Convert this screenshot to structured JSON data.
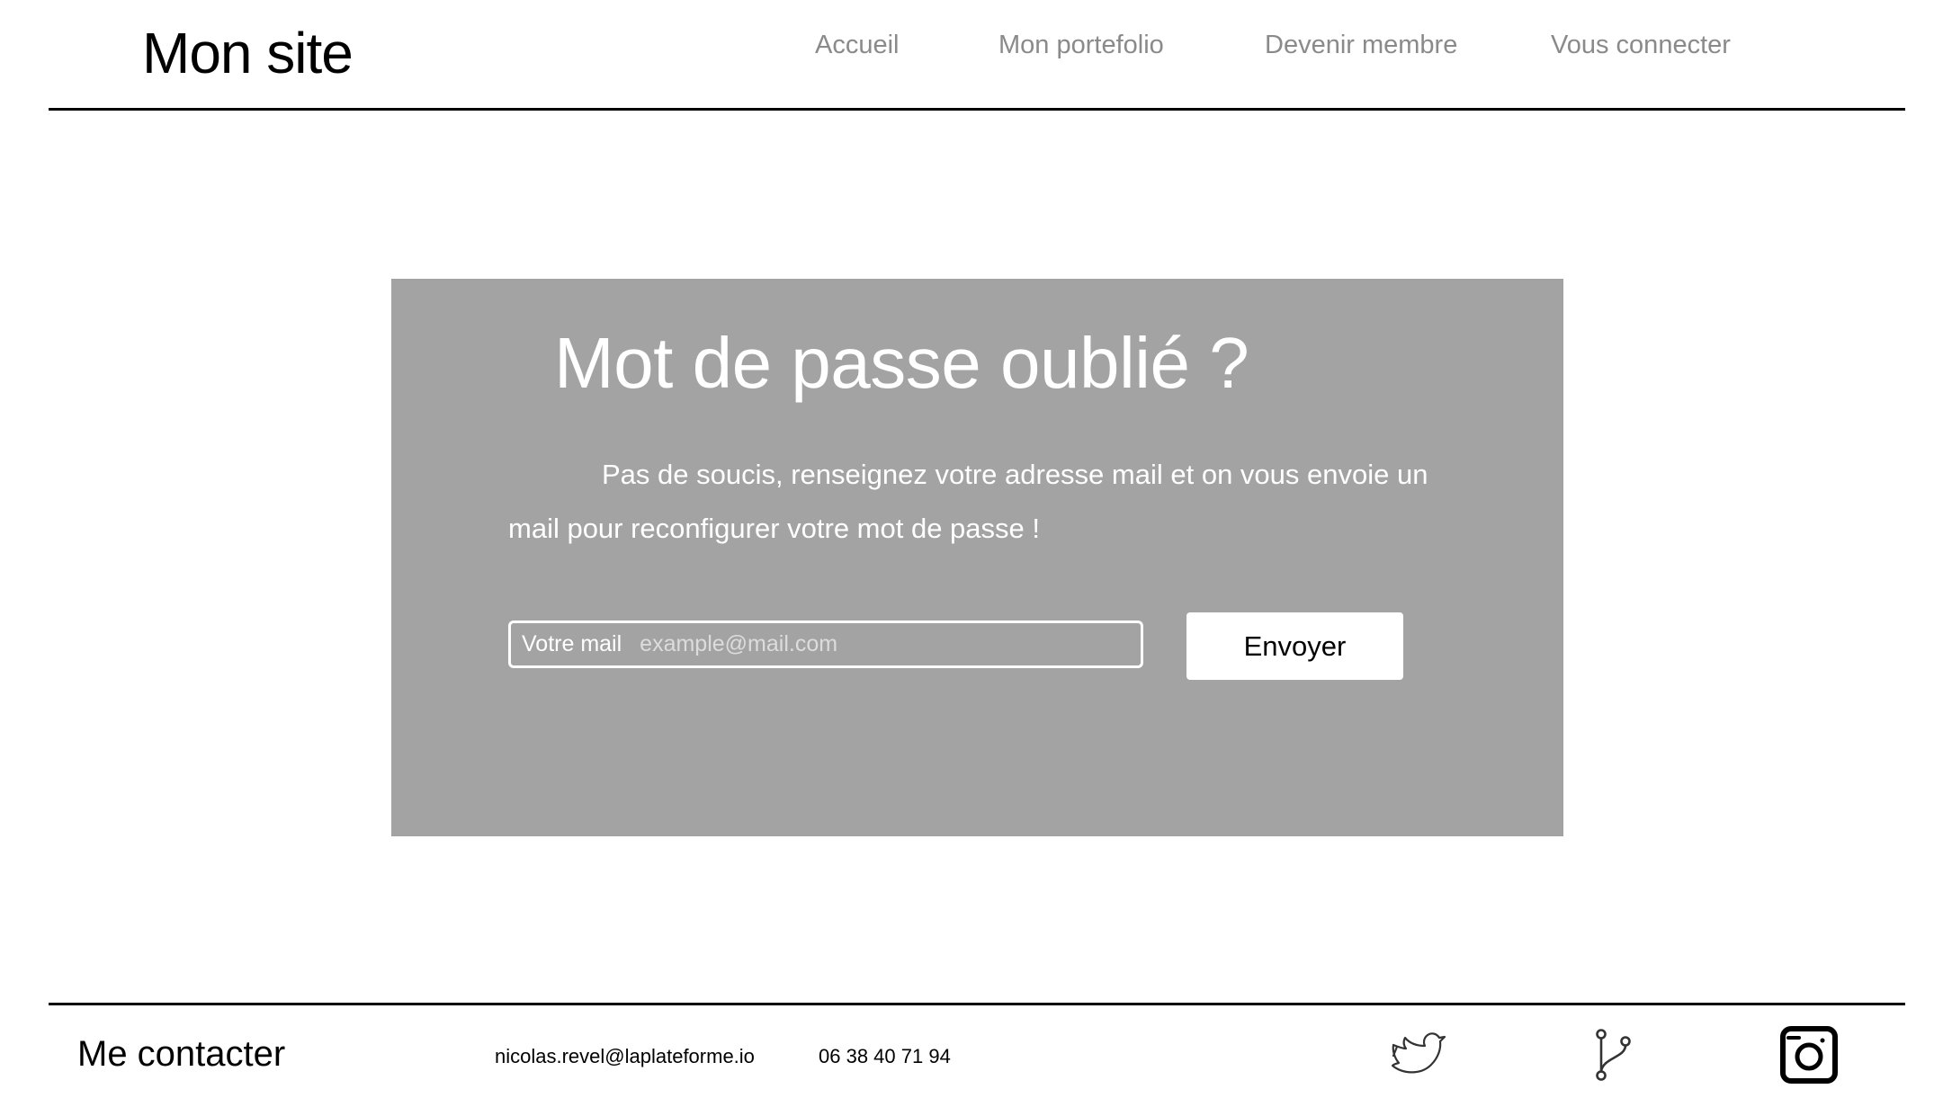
{
  "header": {
    "brand": "Mon site",
    "nav": [
      {
        "label": "Accueil"
      },
      {
        "label": "Mon portefolio"
      },
      {
        "label": "Devenir membre"
      },
      {
        "label": "Vous connecter"
      }
    ]
  },
  "card": {
    "title": "Mot de passe oublié ?",
    "description": "Pas de soucis, renseignez votre adresse mail et on vous envoie un mail pour reconfigurer votre mot de passe !",
    "field_label": "Votre mail",
    "field_placeholder": "example@mail.com",
    "field_value": "",
    "submit_label": "Envoyer"
  },
  "footer": {
    "title": "Me contacter",
    "email": "nicolas.revel@laplateforme.io",
    "phone": "06 38 40 71 94",
    "social": [
      {
        "icon": "twitter-bird-icon"
      },
      {
        "icon": "git-branch-icon"
      },
      {
        "icon": "instagram-icon"
      }
    ]
  },
  "colors": {
    "card_background": "#a3a3a3",
    "nav_text": "#8a8a8a",
    "text": "#000000"
  }
}
